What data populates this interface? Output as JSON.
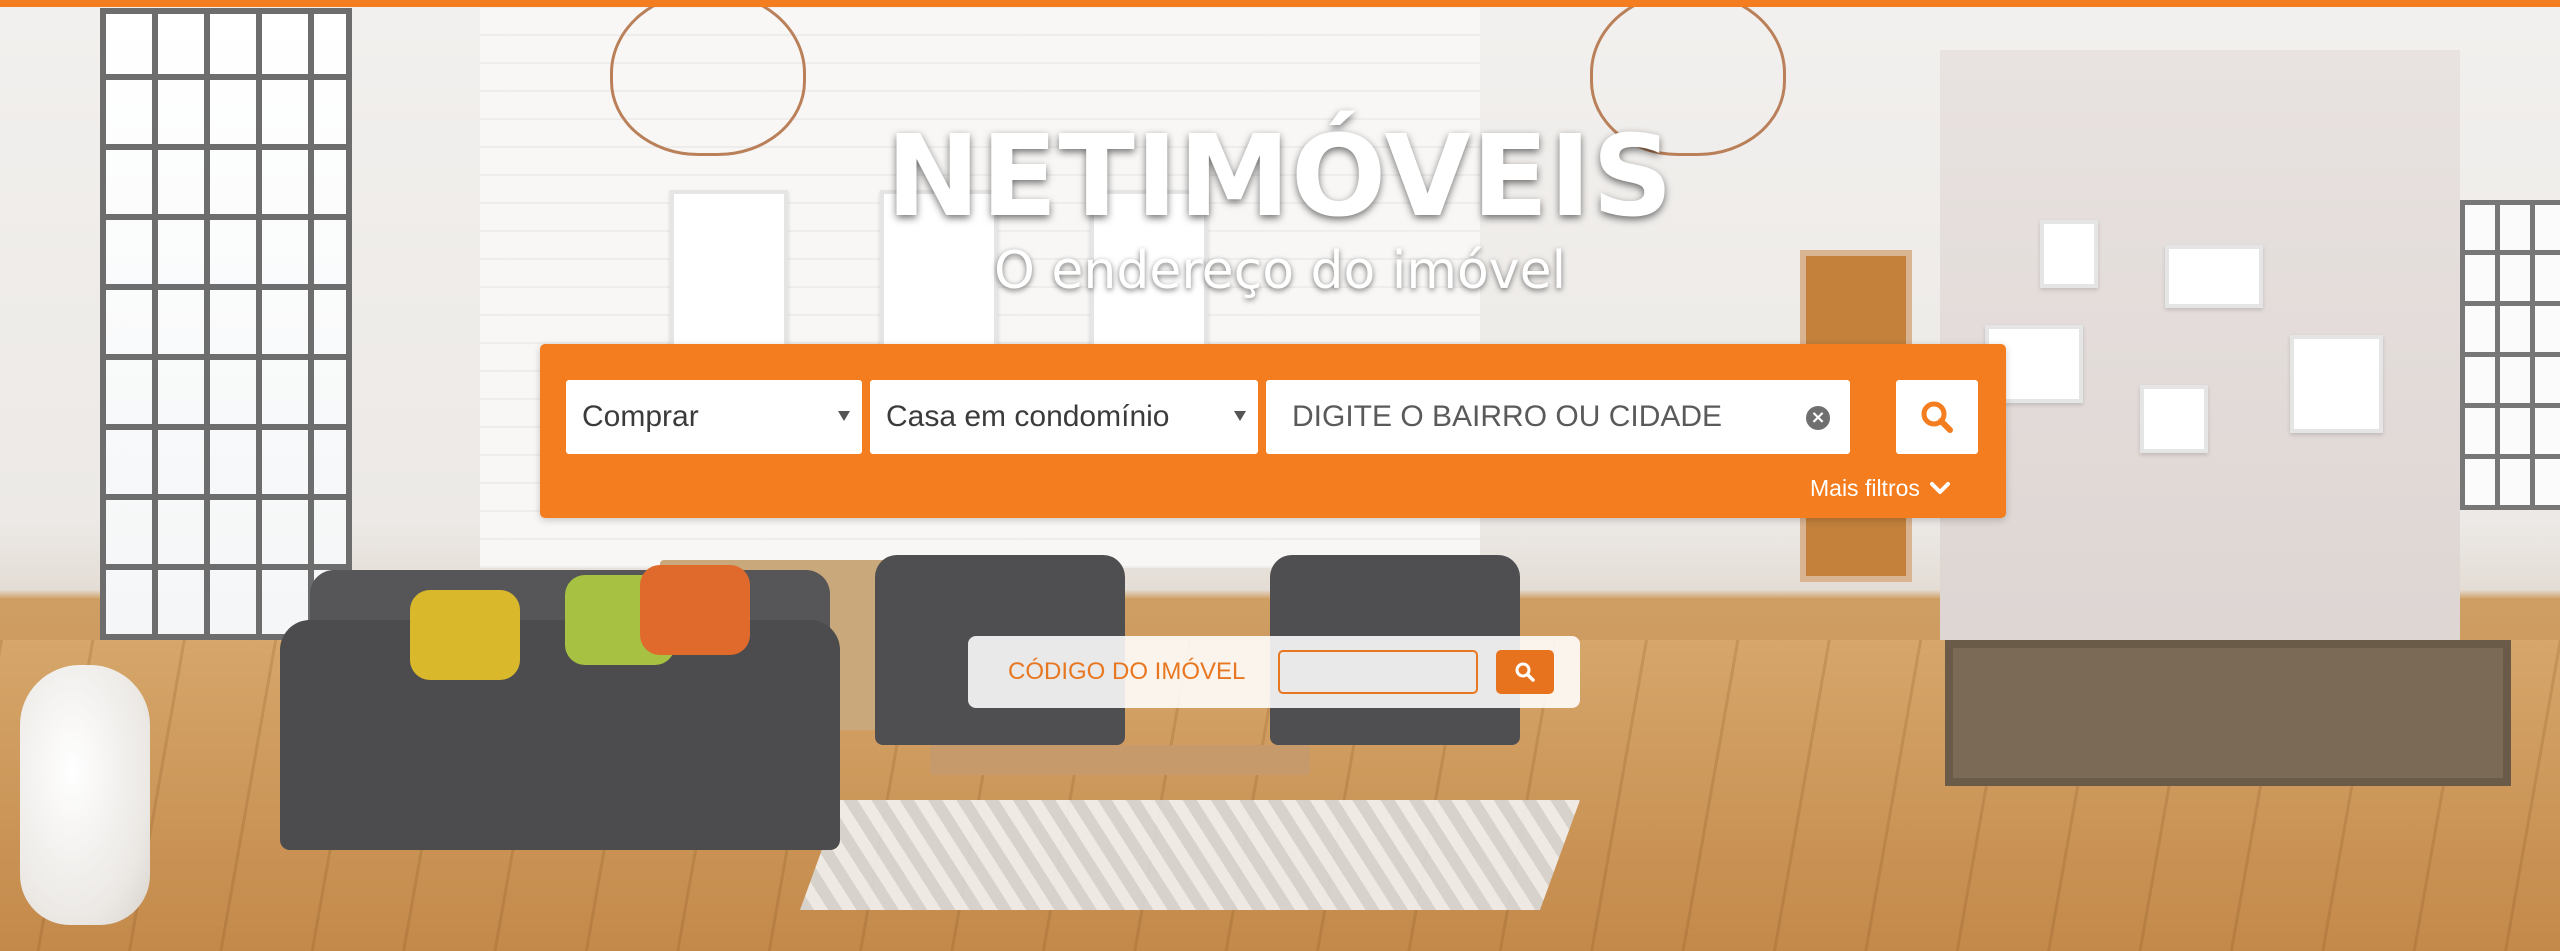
{
  "brand": {
    "title": "NETIMÓVEIS",
    "subtitle": "O endereço do imóvel"
  },
  "colors": {
    "accent": "#f47d1f",
    "code_accent": "#e87722",
    "white": "#ffffff"
  },
  "search": {
    "transaction_selected": "Comprar",
    "property_type_selected": "Casa em condomínio",
    "location_placeholder": "DIGITE O BAIRRO OU CIDADE",
    "location_value": "",
    "clear_icon": "times-circle-icon",
    "search_icon": "search-icon",
    "more_filters_label": "Mais filtros",
    "more_filters_icon": "chevron-down-icon"
  },
  "property_code": {
    "label": "CÓDIGO DO IMÓVEL",
    "value": "",
    "search_icon": "search-icon"
  }
}
